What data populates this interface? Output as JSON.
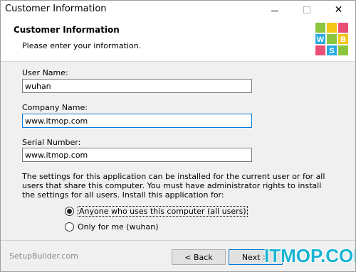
{
  "window": {
    "title": "Customer Information",
    "close_glyph": "✕"
  },
  "header": {
    "title": "Customer Information",
    "subtitle": "Please enter your information.",
    "logo_icon": "wbs-cube-logo-icon",
    "logo_letters": [
      "W",
      "B",
      "S"
    ]
  },
  "form": {
    "user_name_label": "User Name:",
    "user_name_value": "wuhan",
    "company_name_label": "Company Name:",
    "company_name_value": "www.itmop.com",
    "serial_number_label": "Serial Number:",
    "serial_number_value": "www.itmop.com",
    "description": "The settings for this application can be installed for the current user or for all users that share this computer. You must have administrator rights to install the settings for all users. Install this application for:",
    "install_options": [
      {
        "label": "Anyone who uses this computer (all users)",
        "selected": true
      },
      {
        "label": "Only for me (wuhan)",
        "selected": false
      }
    ]
  },
  "footer": {
    "brand": "SetupBuilder.com",
    "back_label": "< Back",
    "next_label": "Next >",
    "watermark": "ITMOP.COM"
  },
  "colors": {
    "accent": "#0078d7",
    "watermark": "#19b4d2",
    "logo_green": "#8cc63f",
    "logo_yellow": "#f5c518",
    "logo_pink": "#e94e77",
    "logo_blue": "#29abe2"
  }
}
